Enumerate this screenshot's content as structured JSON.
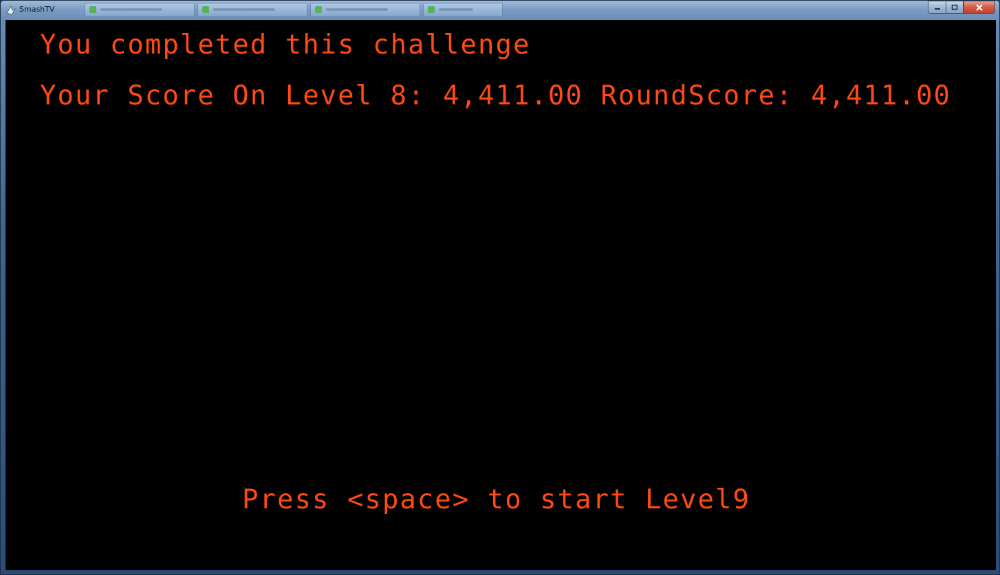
{
  "window": {
    "title": "SmashTV",
    "icon": "smashtv-app-icon",
    "controls": {
      "minimize_icon": "minimize-icon",
      "maximize_icon": "maximize-icon",
      "close_icon": "close-icon"
    }
  },
  "game": {
    "message": "You completed this challenge",
    "score_line": "Your Score On Level 8: 4,411.00 RoundScore: 4,411.00",
    "prompt": "Press <space> to start Level9",
    "text_color": "#ff4a14",
    "background_color": "#000000"
  }
}
